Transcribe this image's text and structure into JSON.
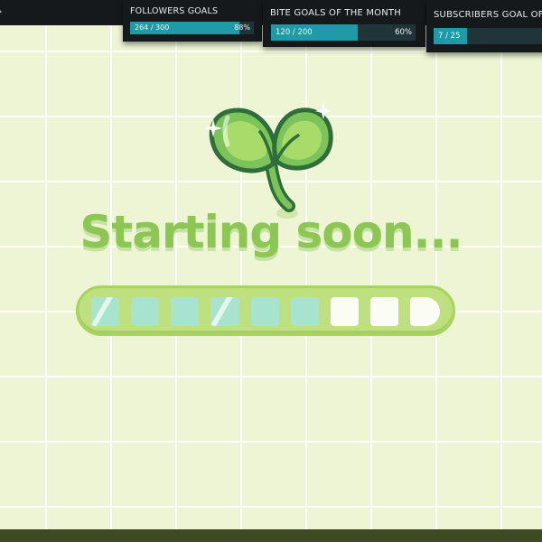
{
  "goals": {
    "followers": {
      "title": "FOLLOWERS GOALS",
      "count": "264 / 300",
      "percent": "88%",
      "progress": 0.88
    },
    "bits": {
      "title": "BITE GOALS OF THE MONTH",
      "count": "120 / 200",
      "percent": "60%",
      "progress": 0.6
    },
    "subscribers": {
      "title": "SUBSCRIBERS GOAL OF",
      "count": "7 / 25",
      "progress": 0.28
    }
  },
  "headline": "Starting soon...",
  "loader": {
    "segments_total": 9,
    "segments_filled": 6
  },
  "colors": {
    "background": "#eef5d4",
    "goal_fill": "#1f9aa6",
    "headline": "#8cc653",
    "loader_fill": "#a8e3cf",
    "panel": "#15191c"
  },
  "icons": {
    "logo": "sprout-icon"
  }
}
